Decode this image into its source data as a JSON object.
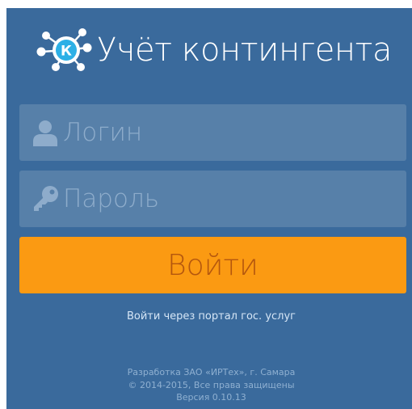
{
  "app": {
    "title": "Учёт контингента",
    "logo_letter": "К"
  },
  "form": {
    "login": {
      "placeholder": "Логин",
      "value": "",
      "icon": "user-icon"
    },
    "password": {
      "placeholder": "Пароль",
      "value": "",
      "icon": "key-icon"
    },
    "submit_label": "Войти"
  },
  "gov_portal_link": "Войти через портал гос. услуг",
  "footer": {
    "line1_prefix": "Разработка ЗАО ",
    "line1_company": "«ИРТех»",
    "line1_suffix": ", г. Самара",
    "line2": "© 2014-2015, Все права защищены",
    "line3": "Версия 0.10.13"
  },
  "colors": {
    "background": "#3a6a9c",
    "field": "#5780a9",
    "button": "#fb9a12",
    "button_text": "#b4570e"
  }
}
